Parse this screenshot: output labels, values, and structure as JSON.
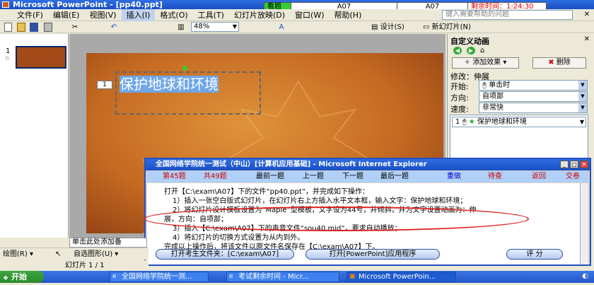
{
  "window": {
    "title": "Microsoft PowerPoint - [pp40.ppt]"
  },
  "menu": {
    "items": [
      "文件(F)",
      "编辑(E)",
      "视图(V)",
      "插入(I)",
      "格式(O)",
      "工具(T)",
      "幻灯片放映(D)",
      "窗口(W)",
      "帮助(H)"
    ],
    "help_placeholder": "键入需要帮助的问题"
  },
  "exam_bar": {
    "label": "看题",
    "code1": "A07",
    "code2": "A07",
    "remaining": "剩余时间：1:24:30"
  },
  "toolbar": {
    "zoom": "48%",
    "design_label": "设计(S)",
    "new_slide_label": "新幻灯片(N)"
  },
  "slides": {
    "number": "1"
  },
  "slide": {
    "text_box": "保护地球和环境",
    "anim_tag": "1"
  },
  "task_pane": {
    "title": "自定义动画",
    "add_effect": "添加效果",
    "delete": "删除",
    "modify": "修改：伸展",
    "start_label": "开始:",
    "start_value": "单击时",
    "direction_label": "方向:",
    "direction_value": "自项部",
    "speed_label": "速度:",
    "speed_value": "非常快",
    "list_item_num": "1",
    "list_item_text": "保护地球和环境"
  },
  "ie_window": {
    "title": "全国网络学院统一测试（中山）[计算机应用基础] - Microsoft Internet Explorer",
    "nav": {
      "current": "第45题",
      "total": "共49题",
      "first": "最前一题",
      "prev": "上一题",
      "next": "下一题",
      "last": "最后一题",
      "redo": "重做",
      "review": "待查",
      "back": "返回",
      "submit": "交卷"
    },
    "lines": [
      "打开【C:\\exam\\A07】下的文件“pp40.ppt”，并完成如下操作：",
      "1）插入一张空白版式幻灯片，在幻灯片右上方插入水平文本框，输入文字：保护地球和环境；",
      "2）将幻灯片设计模板设置为“Maple”型模板，文字设为44号，并倾斜，并为文字设置动画为：伸",
      "展，方向：自项部；",
      "3）插入【C:\\exam\\A07】下的声音文件“sou40.mid”，要求自动播放；",
      "4）将幻灯片的切换方式设置为从内到外。",
      "完成以上操作后，将该文件以原文件名保存在【C:\\exam\\A07】下。"
    ],
    "btn_open_folder": "打开考生文件夹：[C:\\exam\\A07]",
    "btn_open_app": "打开[PowerPoint]应用程序",
    "btn_score": "评 分"
  },
  "notes": {
    "placeholder": "单击此处添加备"
  },
  "drawing": {
    "draw_label": "绘图(R)",
    "autoshape_label": "自选图形(U)"
  },
  "status": {
    "slide_info": "幻灯片 1 / 1"
  },
  "taskbar": {
    "start": "开始",
    "task1": "全国网络学院统一测...",
    "task2": "考试剩余时间 - Micr...",
    "task3": "Microsoft PowerPoin..."
  }
}
